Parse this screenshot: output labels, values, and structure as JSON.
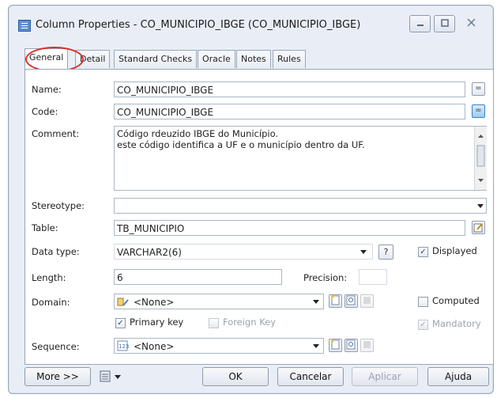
{
  "window": {
    "title": "Column Properties - CO_MUNICIPIO_IBGE (CO_MUNICIPIO_IBGE)"
  },
  "tabs": [
    "General",
    "Detail",
    "Standard Checks",
    "Oracle",
    "Notes",
    "Rules"
  ],
  "form": {
    "name_label": "Name:",
    "name_value": "CO_MUNICIPIO_IBGE",
    "code_label": "Code:",
    "code_value": "CO_MUNICIPIO_IBGE",
    "comment_label": "Comment:",
    "comment_line1": "Código rdeuzido IBGE do Município.",
    "comment_line2": "este código identifica a UF e o município dentro da UF.",
    "stereotype_label": "Stereotype:",
    "stereotype_value": "",
    "table_label": "Table:",
    "table_value": "TB_MUNICIPIO",
    "datatype_label": "Data type:",
    "datatype_value": "VARCHAR2(6)",
    "help_label": "?",
    "displayed_label": "Displayed",
    "length_label": "Length:",
    "length_value": "6",
    "precision_label": "Precision:",
    "precision_value": "",
    "domain_label": "Domain:",
    "domain_value": "<None>",
    "computed_label": "Computed",
    "primary_key_label": "Primary key",
    "foreign_key_label": "Foreign Key",
    "mandatory_label": "Mandatory",
    "sequence_label": "Sequence:",
    "sequence_value": "<None>"
  },
  "checkboxes": {
    "displayed": true,
    "computed": false,
    "primary_key": true,
    "foreign_key": false,
    "mandatory": true
  },
  "footer": {
    "more_label": "More >>",
    "ok_label": "OK",
    "cancel_label": "Cancelar",
    "apply_label": "Aplicar",
    "help_label": "Ajuda"
  },
  "colors": {
    "highlight": "#d9302a",
    "accent_blue": "#3c7fc8"
  }
}
